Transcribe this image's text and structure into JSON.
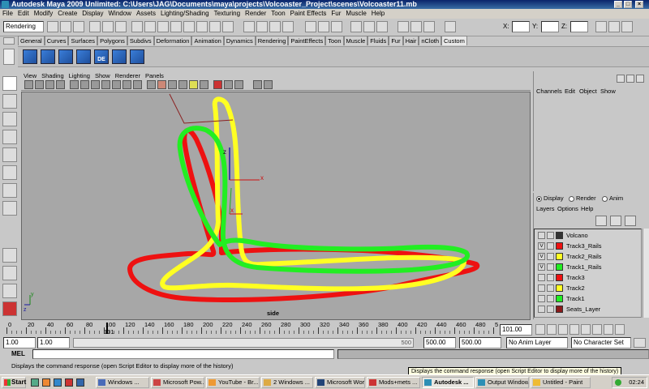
{
  "window": {
    "title": "Autodesk Maya 2009 Unlimited: C:\\Users\\JAG\\Documents\\maya\\projects\\Volcoaster_Project\\scenes\\Volcoaster11.mb",
    "minimize": "_",
    "maximize": "□",
    "close": "×"
  },
  "menubar": [
    "File",
    "Edit",
    "Modify",
    "Create",
    "Display",
    "Window",
    "Assets",
    "Lighting/Shading",
    "Texturing",
    "Render",
    "Toon",
    "Paint Effects",
    "Fur",
    "Muscle",
    "Help"
  ],
  "status_line": {
    "menu_set": "Rendering",
    "x_label": "X:",
    "y_label": "Y:",
    "z_label": "Z:",
    "x_value": "",
    "y_value": "",
    "z_value": ""
  },
  "shelf_tabs": [
    "General",
    "Curves",
    "Surfaces",
    "Polygons",
    "Subdivs",
    "Deformation",
    "Animation",
    "Dynamics",
    "Rendering",
    "PaintEffects",
    "Toon",
    "Muscle",
    "Fluids",
    "Fur",
    "Hair",
    "nCloth",
    "Custom"
  ],
  "shelf_active_tab": "Custom",
  "shelf_icon_label": "DE",
  "viewport": {
    "menu": [
      "View",
      "Shading",
      "Lighting",
      "Show",
      "Renderer",
      "Panels"
    ],
    "camera": "side",
    "axis_labels": {
      "z": "z",
      "x": "x",
      "y": "y"
    },
    "bg_color": "#a7a7a7",
    "track_colors": {
      "track3": "#ee1111",
      "track2": "#ffff22",
      "track1": "#22ee22"
    }
  },
  "channel_box": {
    "menu": [
      "Channels",
      "Edit",
      "Object",
      "Show"
    ]
  },
  "layer_editor": {
    "modes": [
      "Display",
      "Render",
      "Anim"
    ],
    "active_mode": "Display",
    "menu": [
      "Layers",
      "Options",
      "Help"
    ],
    "layers": [
      {
        "name": "Volcano",
        "visible": "",
        "color": "#333333"
      },
      {
        "name": "Track3_Rails",
        "visible": "V",
        "color": "#ee1111"
      },
      {
        "name": "Track2_Rails",
        "visible": "V",
        "color": "#ffff22"
      },
      {
        "name": "Track1_Rails",
        "visible": "V",
        "color": "#22ee22"
      },
      {
        "name": "Track3",
        "visible": "",
        "color": "#ee1111"
      },
      {
        "name": "Track2",
        "visible": "",
        "color": "#ffff22"
      },
      {
        "name": "Track1",
        "visible": "",
        "color": "#22ee22"
      },
      {
        "name": "Seats_Layer",
        "visible": "",
        "color": "#8b1a1a"
      }
    ]
  },
  "time_slider": {
    "ticks": [
      "0",
      "20",
      "40",
      "60",
      "80",
      "100",
      "120",
      "140",
      "160",
      "180",
      "200",
      "220",
      "240",
      "260",
      "280",
      "300",
      "320",
      "340",
      "360",
      "380",
      "400",
      "420",
      "440",
      "460",
      "480",
      "5"
    ],
    "current_marker": "101",
    "current_time": "101.00"
  },
  "range_slider": {
    "start": "1.00",
    "start_anim": "1.00",
    "bar_value": "500",
    "end": "500.00",
    "end_anim": "500.00",
    "anim_layer": "No Anim Layer",
    "character_set": "No Character Set"
  },
  "command_line": {
    "label": "MEL",
    "input": ""
  },
  "help_line": {
    "text": "Displays the command response (open Script Editor to display more of the history)",
    "tooltip": "Displays the command response (open Script Editor to display more of the history)"
  },
  "taskbar": {
    "start": "Start",
    "tasks": [
      "Windows ...",
      "Microsoft Pow...",
      "YouTube - Br...",
      "2 Windows ...",
      "Microsoft Word",
      "Mods+mets ...",
      "Autodesk ...",
      "Output Window",
      "Untitled - Paint"
    ],
    "active_task": "Autodesk ...",
    "clock": "02:24"
  }
}
